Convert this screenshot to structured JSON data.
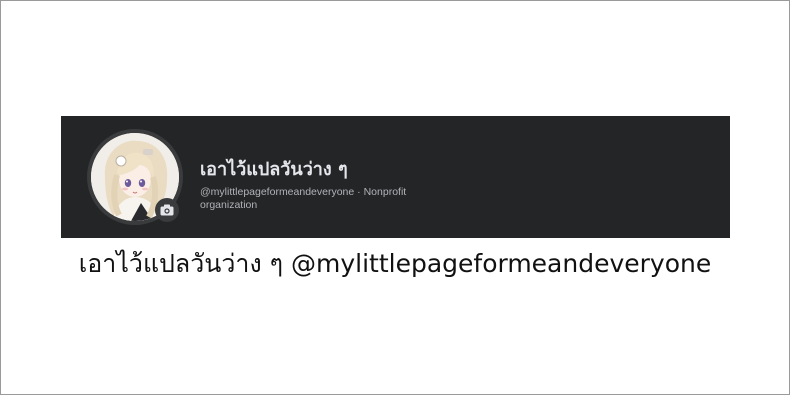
{
  "profile": {
    "name": "เอาไว้แปลวันว่าง ๆ",
    "handle": "@mylittlepageformeandeveryone",
    "separator": " · ",
    "category": "Nonprofit organization"
  },
  "caption": {
    "text": "เอาไว้แปลวันว่าง ๆ @mylittlepageformeandeveryone"
  },
  "icons": {
    "avatar": "anime-avatar-image",
    "camera": "camera-icon"
  },
  "colors": {
    "card_background": "#242526",
    "name_text": "#e4e6eb",
    "meta_text": "#b0b3b8",
    "caption_text": "#111111"
  }
}
